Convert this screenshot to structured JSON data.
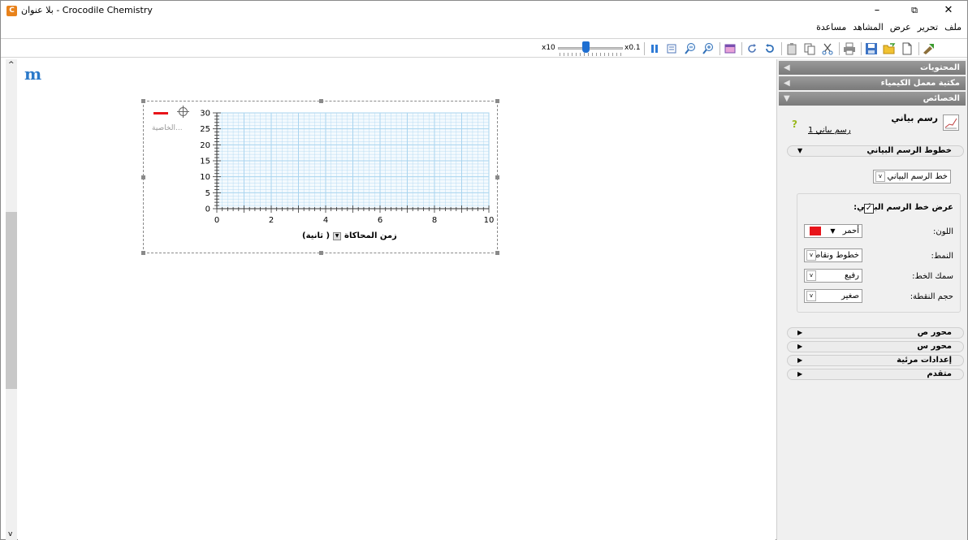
{
  "window": {
    "title": "بلا عنوان - Crocodile Chemistry",
    "app_icon_letter": "C",
    "minimize": "–",
    "restore": "⧉",
    "close": "✕"
  },
  "menu": [
    "ملف",
    "تحرير",
    "عرض",
    "المشاهد",
    "مساعدة"
  ],
  "toolbar": {
    "speed_max": "x10",
    "speed_min": "x0.1",
    "speed_value": 0.55
  },
  "canvas": {
    "logo": "m"
  },
  "graph": {
    "legend_label": "الخاصية...",
    "x_axis_label": "زمن المحاكاة",
    "x_axis_unit": "( ثانية)"
  },
  "chart_data": {
    "type": "line",
    "x": [],
    "series": [],
    "xlim": [
      0,
      10
    ],
    "ylim": [
      0,
      30
    ],
    "xticks": [
      0,
      2,
      4,
      6,
      8,
      10
    ],
    "yticks": [
      0,
      5,
      10,
      15,
      20,
      25,
      30
    ],
    "xlabel": "زمن المحاكاة ( ثانية)",
    "grid": true,
    "grid_color": "#a9d4ef",
    "series_color": "#e8141a"
  },
  "panel": {
    "sections": [
      "المحتويات",
      "مكتبة معمل الكيمياء",
      "الخصائص"
    ],
    "chart_title": "رسم بياني",
    "help": "?",
    "chart_name": "رسم بياني 1",
    "lines_section": "خطوط الرسم البياني",
    "selected_line": "خط الرسم البياني 1",
    "show_line_label": "عرض خط الرسم البياني:",
    "show_line_checked": "✓",
    "color_label": "اللون:",
    "color_value": "أحمر",
    "style_label": "النمط:",
    "style_value": "خطوط ونقاط",
    "thickness_label": "سمك الخط:",
    "thickness_value": "رفيع",
    "point_size_label": "حجم النقطة:",
    "point_size_value": "صغير",
    "collapsed_sections": [
      "محور ص",
      "محور س",
      "إعدادات مرئية",
      "متقدم"
    ]
  }
}
